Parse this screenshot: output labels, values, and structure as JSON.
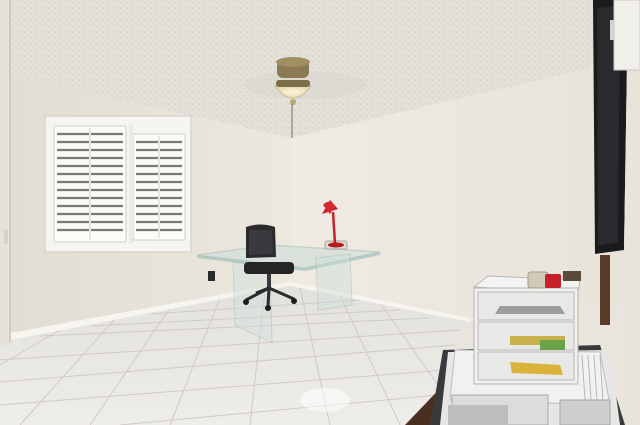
{
  "scene": {
    "description_label": "",
    "objects": [
      "textured-ceiling",
      "ceiling-fan",
      "shuttered-window",
      "glass-desk",
      "office-chair",
      "red-desk-lamp",
      "plastic-drawer-organizer",
      "wall-mounted-tv",
      "tile-floor"
    ],
    "colors": {
      "wall_left": "#ece8df",
      "wall_back": "#eeeae2",
      "ceiling": "#e6e3dd",
      "floor": "#e7e5e0",
      "tile_grout": "#cfcbc3",
      "shutter": "#f4f3ef",
      "lamp": "#c8202a",
      "chair": "#2a2a2d",
      "fan_brass": "#8a7a55",
      "fan_light": "#f3e7c3",
      "tv": "#1b1b1d",
      "cabinet_dark": "#4a2f20"
    }
  }
}
